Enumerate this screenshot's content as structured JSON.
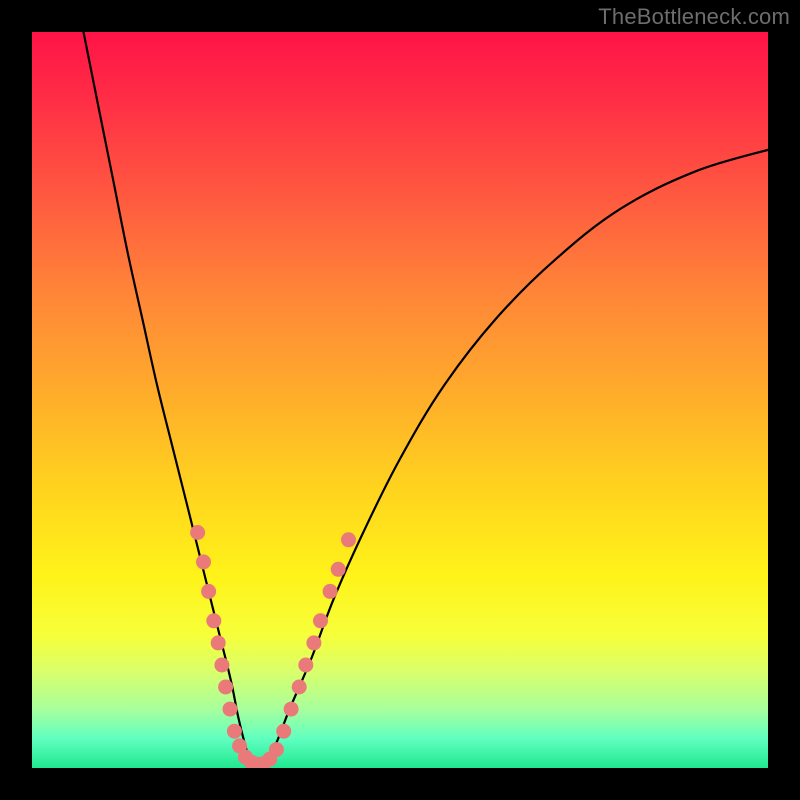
{
  "watermark": "TheBottleneck.com",
  "chart_data": {
    "type": "line",
    "title": "",
    "xlabel": "",
    "ylabel": "",
    "xlim": [
      0,
      100
    ],
    "ylim": [
      0,
      100
    ],
    "series": [
      {
        "name": "bottleneck-curve",
        "x": [
          7,
          9,
          11,
          13,
          15,
          17,
          19,
          21,
          23,
          25,
          27,
          28,
          29,
          30,
          31,
          33,
          35,
          38,
          41,
          45,
          50,
          56,
          63,
          71,
          80,
          90,
          100
        ],
        "y": [
          100,
          90,
          80,
          70,
          61,
          52,
          44,
          36,
          28,
          20,
          12,
          7,
          3,
          0,
          0,
          3,
          8,
          15,
          23,
          32,
          42,
          52,
          61,
          69,
          76,
          81,
          84
        ]
      }
    ],
    "markers": {
      "name": "highlight-dots",
      "color": "#ea7a7a",
      "points": [
        {
          "x": 22.5,
          "y": 32
        },
        {
          "x": 23.3,
          "y": 28
        },
        {
          "x": 24.0,
          "y": 24
        },
        {
          "x": 24.7,
          "y": 20
        },
        {
          "x": 25.3,
          "y": 17
        },
        {
          "x": 25.8,
          "y": 14
        },
        {
          "x": 26.3,
          "y": 11
        },
        {
          "x": 26.9,
          "y": 8
        },
        {
          "x": 27.5,
          "y": 5
        },
        {
          "x": 28.2,
          "y": 3
        },
        {
          "x": 29.0,
          "y": 1.5
        },
        {
          "x": 29.8,
          "y": 0.8
        },
        {
          "x": 30.6,
          "y": 0.5
        },
        {
          "x": 31.5,
          "y": 0.6
        },
        {
          "x": 32.3,
          "y": 1.2
        },
        {
          "x": 33.2,
          "y": 2.5
        },
        {
          "x": 34.2,
          "y": 5
        },
        {
          "x": 35.2,
          "y": 8
        },
        {
          "x": 36.3,
          "y": 11
        },
        {
          "x": 37.2,
          "y": 14
        },
        {
          "x": 38.3,
          "y": 17
        },
        {
          "x": 39.2,
          "y": 20
        },
        {
          "x": 40.5,
          "y": 24
        },
        {
          "x": 41.6,
          "y": 27
        },
        {
          "x": 43.0,
          "y": 31
        }
      ]
    },
    "gradient_stops": [
      {
        "pos": 0,
        "color": "#ff1447"
      },
      {
        "pos": 22,
        "color": "#ff5840"
      },
      {
        "pos": 48,
        "color": "#ffa92c"
      },
      {
        "pos": 74,
        "color": "#fff31a"
      },
      {
        "pos": 92,
        "color": "#a8ff9c"
      },
      {
        "pos": 100,
        "color": "#20e890"
      }
    ]
  }
}
